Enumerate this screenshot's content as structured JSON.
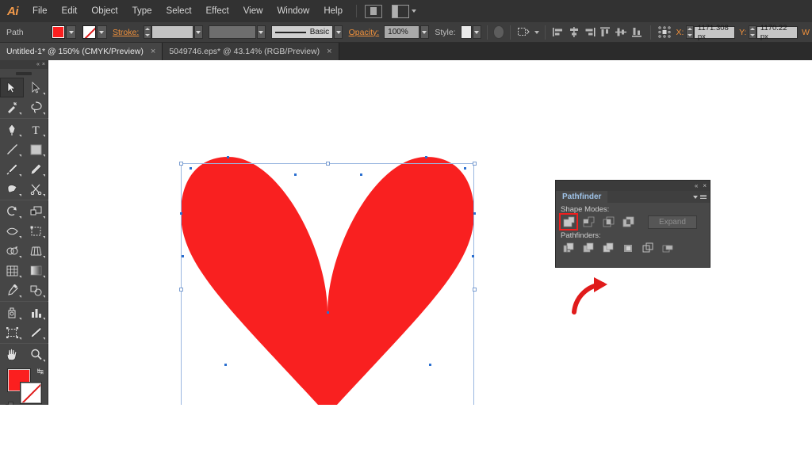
{
  "app": {
    "name": "Adobe Illustrator",
    "logo_text": "Ai"
  },
  "menubar": {
    "items": [
      {
        "label": "File"
      },
      {
        "label": "Edit"
      },
      {
        "label": "Object"
      },
      {
        "label": "Type"
      },
      {
        "label": "Select"
      },
      {
        "label": "Effect"
      },
      {
        "label": "View"
      },
      {
        "label": "Window"
      },
      {
        "label": "Help"
      }
    ],
    "bridge_icon": "bridge-icon",
    "arrange_icon": "arrange-documents-icon"
  },
  "controlbar": {
    "object_label": "Path",
    "fill_color": "#FB1F1F",
    "stroke_label": "Stroke:",
    "stroke_weight": "",
    "stroke_profile": "",
    "brush_label": "Basic",
    "opacity_label": "Opacity:",
    "opacity_value": "100%",
    "style_label": "Style:",
    "recolor_icon": "recolor-artwork-icon",
    "transform_icon": "transform-icon",
    "align_icons": [
      "align-left-icon",
      "align-center-h-icon",
      "align-right-icon",
      "align-top-icon",
      "align-middle-v-icon",
      "align-bottom-icon"
    ],
    "reference_point_icon": "reference-point-icon",
    "x_label": "X:",
    "x_value": "1171.308 px",
    "y_label": "Y:",
    "y_value": "1170.22 px",
    "w_label": "W"
  },
  "tabs": [
    {
      "label": "Untitled-1* @ 150% (CMYK/Preview)",
      "close": "×",
      "active": true
    },
    {
      "label": "5049746.eps* @ 43.14% (RGB/Preview)",
      "close": "×",
      "active": false
    }
  ],
  "toolbar": {
    "collapse_icon": "«",
    "close_icon": "×",
    "tools": [
      {
        "name": "selection-tool",
        "selected": true
      },
      {
        "name": "direct-selection-tool",
        "selected": false
      },
      {
        "name": "magic-wand-tool",
        "selected": false
      },
      {
        "name": "lasso-tool",
        "selected": false
      },
      {
        "name": "pen-tool",
        "selected": false
      },
      {
        "name": "type-tool",
        "selected": false
      },
      {
        "name": "line-segment-tool",
        "selected": false
      },
      {
        "name": "rectangle-tool",
        "selected": false
      },
      {
        "name": "paintbrush-tool",
        "selected": false
      },
      {
        "name": "pencil-tool",
        "selected": false
      },
      {
        "name": "blob-brush-tool",
        "selected": false
      },
      {
        "name": "eraser-scissors-tool",
        "selected": false
      },
      {
        "name": "rotate-tool",
        "selected": false
      },
      {
        "name": "scale-tool",
        "selected": false
      },
      {
        "name": "width-tool",
        "selected": false
      },
      {
        "name": "free-transform-tool",
        "selected": false
      },
      {
        "name": "shape-builder-tool",
        "selected": false
      },
      {
        "name": "perspective-grid-tool",
        "selected": false
      },
      {
        "name": "mesh-tool",
        "selected": false
      },
      {
        "name": "gradient-tool",
        "selected": false
      },
      {
        "name": "eyedropper-tool",
        "selected": false
      },
      {
        "name": "blend-tool",
        "selected": false
      },
      {
        "name": "symbol-sprayer-tool",
        "selected": false
      },
      {
        "name": "column-graph-tool",
        "selected": false
      },
      {
        "name": "artboard-tool",
        "selected": false
      },
      {
        "name": "slice-tool",
        "selected": false
      },
      {
        "name": "hand-tool",
        "selected": false
      },
      {
        "name": "zoom-tool",
        "selected": false
      }
    ],
    "fill_color": "#FB1F1F",
    "stroke_color": "none",
    "color_mode_buttons": [
      {
        "name": "color-button",
        "active": true
      },
      {
        "name": "gradient-button",
        "active": false
      },
      {
        "name": "none-button",
        "active": false
      }
    ],
    "drawing_mode_buttons": [
      {
        "name": "draw-normal-button"
      },
      {
        "name": "draw-behind-button"
      },
      {
        "name": "draw-inside-button"
      }
    ],
    "screen_mode_button": "change-screen-mode-button"
  },
  "pathfinder": {
    "title": "Pathfinder",
    "collapse_icon": "«",
    "close_icon": "×",
    "shape_modes_label": "Shape Modes:",
    "shape_modes": [
      {
        "name": "unite-button",
        "highlighted": true
      },
      {
        "name": "minus-front-button",
        "highlighted": false
      },
      {
        "name": "intersect-button",
        "highlighted": false
      },
      {
        "name": "exclude-button",
        "highlighted": false
      }
    ],
    "expand_label": "Expand",
    "pathfinders_label": "Pathfinders:",
    "pathfinders": [
      {
        "name": "divide-button"
      },
      {
        "name": "trim-button"
      },
      {
        "name": "merge-button"
      },
      {
        "name": "crop-button"
      },
      {
        "name": "outline-button"
      },
      {
        "name": "minus-back-button"
      }
    ],
    "highlight_color": "#F01F1F"
  },
  "canvas": {
    "shape_name": "heart-shape",
    "shape_fill": "#F92020",
    "selection_color": "#9AB6E0",
    "anchor_color": "#2A6FD0",
    "annotation_arrow": "red-curved-arrow",
    "annotation_color": "#E01B1B"
  }
}
